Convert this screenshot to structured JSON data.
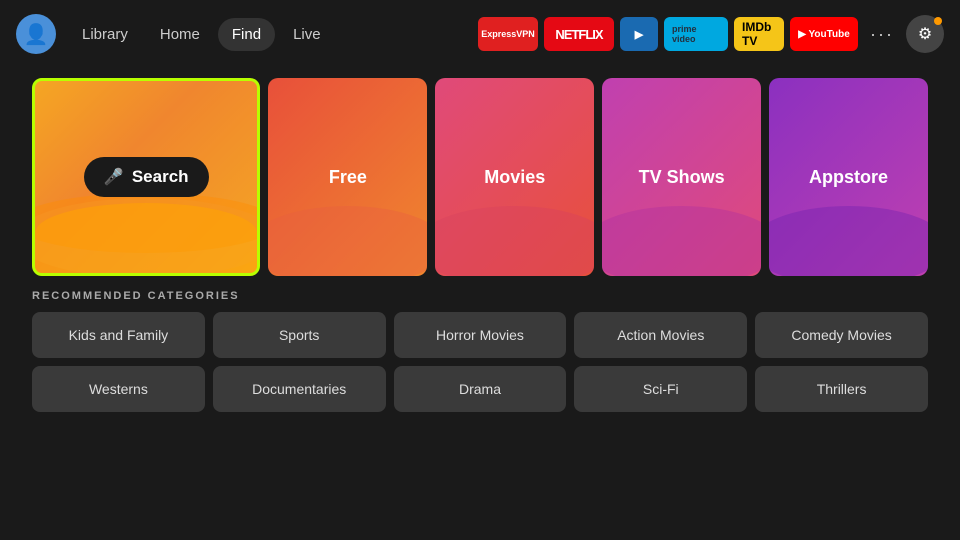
{
  "nav": {
    "avatar_icon": "👤",
    "links": [
      {
        "label": "Library",
        "active": false
      },
      {
        "label": "Home",
        "active": false
      },
      {
        "label": "Find",
        "active": true
      },
      {
        "label": "Live",
        "active": false
      }
    ],
    "apps": [
      {
        "name": "ExpressVPN",
        "class": "app-express",
        "label": "ExpressVPN"
      },
      {
        "name": "Netflix",
        "class": "app-netflix",
        "label": "NETFLIX"
      },
      {
        "name": "Paramount",
        "class": "app-paramount",
        "label": "▶"
      },
      {
        "name": "PrimeVideo",
        "class": "app-prime",
        "label": "prime video"
      },
      {
        "name": "IMDbTV",
        "class": "app-imdb",
        "label": "IMDb TV"
      },
      {
        "name": "YouTube",
        "class": "app-youtube",
        "label": "▶ YouTube"
      }
    ],
    "more_label": "···",
    "settings_icon": "⚙"
  },
  "tiles": [
    {
      "id": "search",
      "label": "Search",
      "type": "search"
    },
    {
      "id": "free",
      "label": "Free",
      "type": "free"
    },
    {
      "id": "movies",
      "label": "Movies",
      "type": "movies"
    },
    {
      "id": "tvshows",
      "label": "TV Shows",
      "type": "tvshows"
    },
    {
      "id": "appstore",
      "label": "Appstore",
      "type": "appstore"
    }
  ],
  "recommended": {
    "title": "RECOMMENDED CATEGORIES",
    "rows": [
      [
        {
          "label": "Kids and Family"
        },
        {
          "label": "Sports"
        },
        {
          "label": "Horror Movies"
        },
        {
          "label": "Action Movies"
        },
        {
          "label": "Comedy Movies"
        }
      ],
      [
        {
          "label": "Westerns"
        },
        {
          "label": "Documentaries"
        },
        {
          "label": "Drama"
        },
        {
          "label": "Sci-Fi"
        },
        {
          "label": "Thrillers"
        }
      ]
    ]
  }
}
